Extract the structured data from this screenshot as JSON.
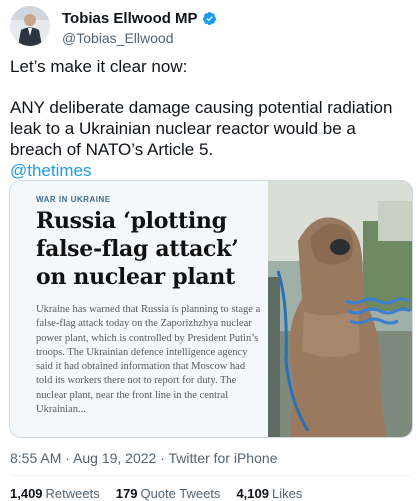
{
  "author": {
    "name": "Tobias Ellwood MP",
    "handle": "@Tobias_Ellwood",
    "verified_color": "#1d9bf0"
  },
  "tweet": {
    "line1": "Let’s make it clear now:",
    "line2": "ANY deliberate damage causing potential radiation leak to a Ukrainian nuclear reactor would be a breach of NATO’s Article 5.",
    "mention": "@thetimes"
  },
  "card": {
    "kicker": "WAR IN UKRAINE",
    "headline": "Russia ‘plotting false-flag attack’ on nuclear plant",
    "body": "Ukraine has warned that Russia is planning to stage a false-flag attack today on the Zaporizhzhya nuclear power plant, which is controlled by President Putin’s troops. The Ukrainian defence intelligence agency said it had obtained information that Moscow had told its workers there not to report for duty. The nuclear plant, near the front line in the central Ukrainian..."
  },
  "meta": {
    "timestamp": "8:55 AM · Aug 19, 2022 · Twitter for iPhone"
  },
  "stats": {
    "retweets_count": "1,409",
    "retweets_label": "Retweets",
    "quotes_count": "179",
    "quotes_label": "Quote Tweets",
    "likes_count": "4,109",
    "likes_label": "Likes"
  },
  "colors": {
    "link": "#1d9bf0",
    "secondary_text": "#536471",
    "kicker": "#3d6d8a"
  }
}
